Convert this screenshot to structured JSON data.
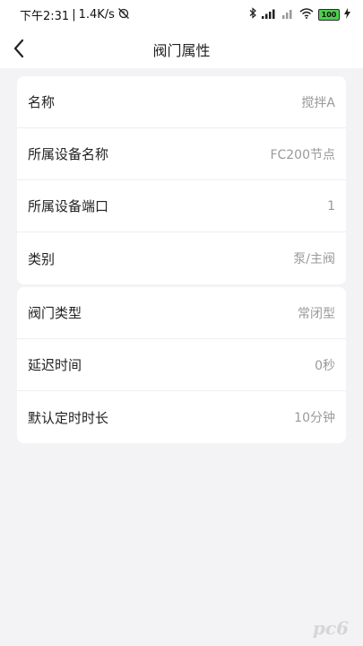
{
  "status_bar": {
    "time": "下午2:31",
    "network_speed": "1.4K/s",
    "battery_level": "100"
  },
  "header": {
    "title": "阀门属性"
  },
  "section1": {
    "rows": [
      {
        "label": "名称",
        "value": "搅拌A"
      },
      {
        "label": "所属设备名称",
        "value": "FC200节点"
      },
      {
        "label": "所属设备端口",
        "value": "1"
      },
      {
        "label": "类别",
        "value": "泵/主阀"
      }
    ]
  },
  "section2": {
    "rows": [
      {
        "label": "阀门类型",
        "value": "常闭型"
      },
      {
        "label": "延迟时间",
        "value": "0秒"
      },
      {
        "label": "默认定时时长",
        "value": "10分钟"
      }
    ]
  },
  "watermark": "pc6"
}
